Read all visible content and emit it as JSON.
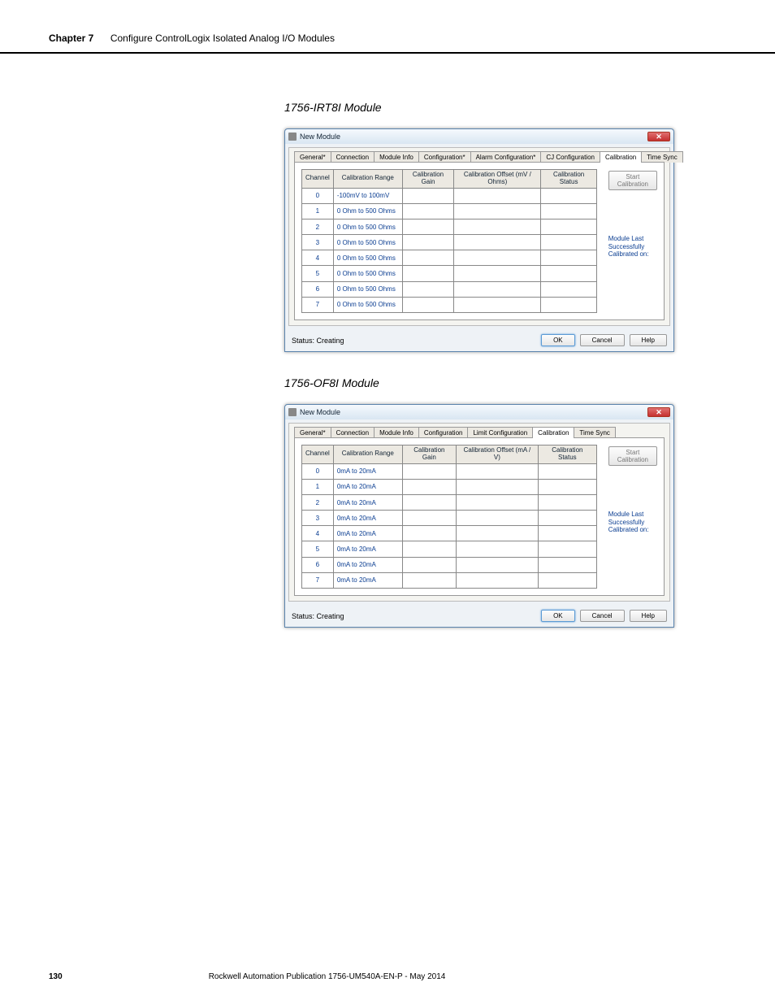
{
  "page": {
    "chapter_label": "Chapter 7",
    "chapter_title": "Configure ControlLogix Isolated Analog I/O Modules",
    "footer_page": "130",
    "footer_pub": "Rockwell Automation Publication 1756-UM540A-EN-P - May 2014"
  },
  "dialogs": [
    {
      "heading": "1756-IRT8I Module",
      "window_title": "New Module",
      "tabs": [
        "General*",
        "Connection",
        "Module Info",
        "Configuration*",
        "Alarm Configuration*",
        "CJ Configuration",
        "Calibration",
        "Time Sync"
      ],
      "active_tab_index": 6,
      "columns": {
        "channel": "Channel",
        "range": "Calibration Range",
        "gain": "Calibration Gain",
        "offset": "Calibration Offset (mV / Ohms)",
        "status": "Calibration Status"
      },
      "rows": [
        {
          "ch": "0",
          "range": "-100mV to 100mV"
        },
        {
          "ch": "1",
          "range": "0 Ohm to 500 Ohms"
        },
        {
          "ch": "2",
          "range": "0 Ohm to 500 Ohms"
        },
        {
          "ch": "3",
          "range": "0 Ohm to 500 Ohms"
        },
        {
          "ch": "4",
          "range": "0 Ohm to 500 Ohms"
        },
        {
          "ch": "5",
          "range": "0 Ohm to 500 Ohms"
        },
        {
          "ch": "6",
          "range": "0 Ohm to 500 Ohms"
        },
        {
          "ch": "7",
          "range": "0 Ohm to 500 Ohms"
        }
      ],
      "start_button": "Start Calibration",
      "module_last_1": "Module Last Successfully",
      "module_last_2": "Calibrated on:",
      "status_text": "Status: Creating",
      "buttons": {
        "ok": "OK",
        "cancel": "Cancel",
        "help": "Help"
      }
    },
    {
      "heading": "1756-OF8I Module",
      "window_title": "New Module",
      "tabs": [
        "General*",
        "Connection",
        "Module Info",
        "Configuration",
        "Limit Configuration",
        "Calibration",
        "Time Sync"
      ],
      "active_tab_index": 5,
      "columns": {
        "channel": "Channel",
        "range": "Calibration Range",
        "gain": "Calibration Gain",
        "offset": "Calibration Offset (mA / V)",
        "status": "Calibration Status"
      },
      "rows": [
        {
          "ch": "0",
          "range": "0mA to 20mA"
        },
        {
          "ch": "1",
          "range": "0mA to 20mA"
        },
        {
          "ch": "2",
          "range": "0mA to 20mA"
        },
        {
          "ch": "3",
          "range": "0mA to 20mA"
        },
        {
          "ch": "4",
          "range": "0mA to 20mA"
        },
        {
          "ch": "5",
          "range": "0mA to 20mA"
        },
        {
          "ch": "6",
          "range": "0mA to 20mA"
        },
        {
          "ch": "7",
          "range": "0mA to 20mA"
        }
      ],
      "start_button": "Start Calibration",
      "module_last_1": "Module Last Successfully",
      "module_last_2": "Calibrated on:",
      "status_text": "Status: Creating",
      "buttons": {
        "ok": "OK",
        "cancel": "Cancel",
        "help": "Help"
      }
    }
  ]
}
